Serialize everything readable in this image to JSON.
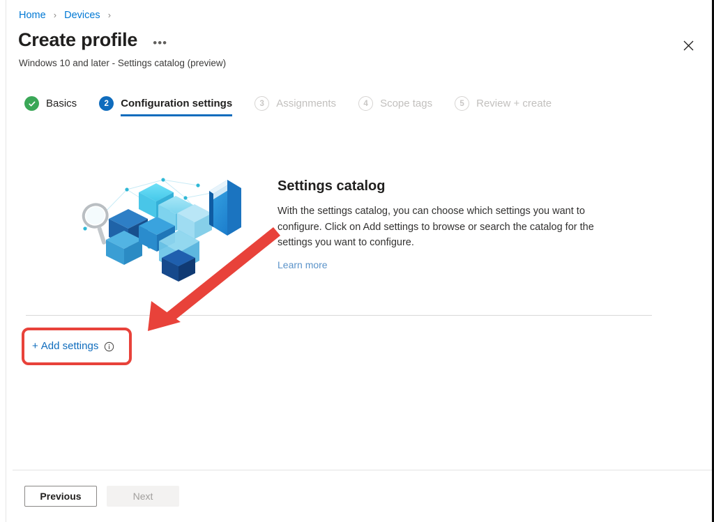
{
  "breadcrumb": {
    "items": [
      {
        "label": "Home",
        "link": true
      },
      {
        "label": "Devices",
        "link": true
      }
    ],
    "separator": "›"
  },
  "header": {
    "title": "Create profile",
    "more_label": "•••",
    "subtitle": "Windows 10 and later - Settings catalog (preview)",
    "close_label": "Close"
  },
  "wizard": {
    "steps": [
      {
        "num": "✓",
        "label": "Basics",
        "state": "done"
      },
      {
        "num": "2",
        "label": "Configuration settings",
        "state": "active"
      },
      {
        "num": "3",
        "label": "Assignments",
        "state": "todo"
      },
      {
        "num": "4",
        "label": "Scope tags",
        "state": "todo"
      },
      {
        "num": "5",
        "label": "Review + create",
        "state": "todo"
      }
    ]
  },
  "hero": {
    "title": "Settings catalog",
    "body": "With the settings catalog, you can choose which settings you want to configure. Click on Add settings to browse or search the catalog for the settings you want to configure.",
    "learn_more": "Learn more",
    "illustration_name": "settings-catalog-illustration"
  },
  "actions": {
    "add_settings_plus": "+",
    "add_settings_label": "Add settings",
    "info_tooltip": "Information"
  },
  "annotation": {
    "arrow_color": "#e8423a",
    "box_color": "#e8423a",
    "arrow_name": "red-annotation-arrow",
    "box_name": "red-annotation-highlight"
  },
  "footer": {
    "previous_label": "Previous",
    "next_label": "Next",
    "next_disabled": true
  },
  "colors": {
    "accent": "#0f6cbd",
    "link": "#0078d4",
    "success": "#3aa757",
    "text": "#201f1e",
    "muted": "#c2c0be",
    "annotation": "#e8423a"
  }
}
